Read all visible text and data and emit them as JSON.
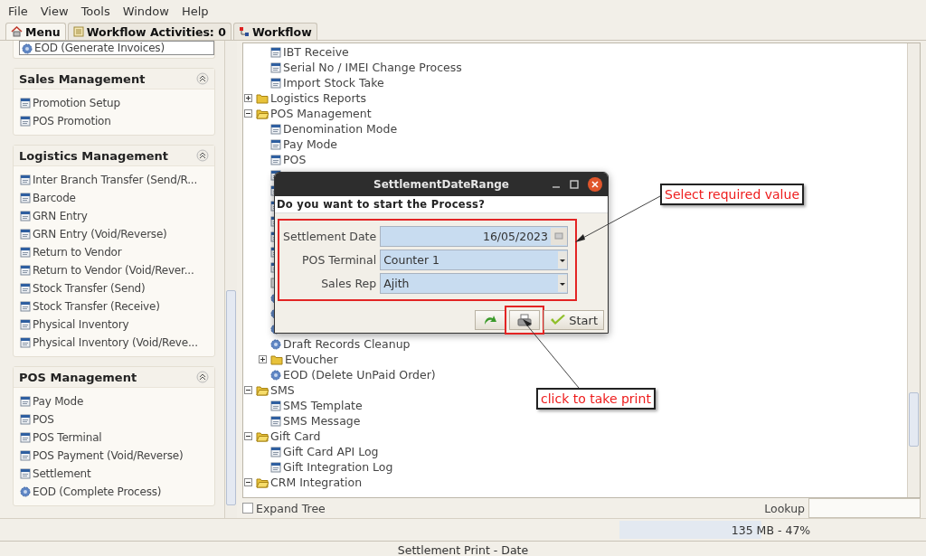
{
  "menu_bar": [
    "File",
    "View",
    "Tools",
    "Window",
    "Help"
  ],
  "tabs": [
    {
      "label": "Menu",
      "selected": true
    },
    {
      "label": "Workflow Activities: 0",
      "selected": false
    },
    {
      "label": "Workflow",
      "selected": false
    }
  ],
  "sidebar": {
    "sections": [
      {
        "items": [
          {
            "label": "EOD (Generate Invoices)",
            "kind": "process",
            "selected": true
          }
        ]
      },
      {
        "title": "Sales Management",
        "items": [
          {
            "label": "Promotion Setup",
            "kind": "form",
            "selected": false
          },
          {
            "label": "POS Promotion",
            "kind": "form",
            "selected": false
          }
        ]
      },
      {
        "title": "Logistics Management",
        "items": [
          {
            "label": "Inter Branch Transfer (Send/R...",
            "kind": "form",
            "selected": false
          },
          {
            "label": "Barcode",
            "kind": "form",
            "selected": false
          },
          {
            "label": "GRN Entry",
            "kind": "form",
            "selected": false
          },
          {
            "label": "GRN Entry (Void/Reverse)",
            "kind": "form",
            "selected": false
          },
          {
            "label": "Return to Vendor",
            "kind": "form",
            "selected": false
          },
          {
            "label": "Return to Vendor (Void/Rever...",
            "kind": "form",
            "selected": false
          },
          {
            "label": "Stock Transfer (Send)",
            "kind": "form",
            "selected": false
          },
          {
            "label": "Stock Transfer (Receive)",
            "kind": "form",
            "selected": false
          },
          {
            "label": "Physical Inventory",
            "kind": "form",
            "selected": false
          },
          {
            "label": "Physical Inventory (Void/Reve...",
            "kind": "form",
            "selected": false
          }
        ]
      },
      {
        "title": "POS Management",
        "items": [
          {
            "label": "Pay Mode",
            "kind": "form",
            "selected": false
          },
          {
            "label": "POS",
            "kind": "form",
            "selected": false
          },
          {
            "label": "POS Terminal",
            "kind": "form",
            "selected": false
          },
          {
            "label": "POS Payment (Void/Reverse)",
            "kind": "form",
            "selected": false
          },
          {
            "label": "Settlement",
            "kind": "form",
            "selected": false
          },
          {
            "label": "EOD (Complete Process)",
            "kind": "process",
            "selected": false
          }
        ]
      }
    ]
  },
  "tree": [
    {
      "kind": "continued",
      "children": [
        {
          "label": "IBT Receive",
          "kind": "form"
        },
        {
          "label": "Serial No / IMEI Change Process",
          "kind": "form"
        },
        {
          "label": "Import Stock Take",
          "kind": "form"
        }
      ]
    },
    {
      "label": "Logistics Reports",
      "kind": "folder",
      "expanded": false
    },
    {
      "label": "POS Management",
      "kind": "folder",
      "expanded": true,
      "children": [
        {
          "label": "Denomination Mode",
          "kind": "form"
        },
        {
          "label": "Pay Mode",
          "kind": "form"
        },
        {
          "label": "POS",
          "kind": "form"
        },
        {
          "kind": "form"
        },
        {
          "kind": "form"
        },
        {
          "kind": "form"
        },
        {
          "kind": "form"
        },
        {
          "kind": "form"
        },
        {
          "kind": "form"
        },
        {
          "kind": "form"
        },
        {
          "kind": "blank"
        },
        {
          "kind": "process"
        },
        {
          "kind": "process"
        },
        {
          "kind": "process"
        },
        {
          "label": "Draft Records Cleanup",
          "kind": "process"
        },
        {
          "label": "EVoucher",
          "kind": "folder",
          "expanded": false
        },
        {
          "label": "EOD (Delete UnPaid Order)",
          "kind": "process"
        }
      ]
    },
    {
      "label": "SMS",
      "kind": "folder",
      "expanded": true,
      "children": [
        {
          "label": "SMS Template",
          "kind": "form"
        },
        {
          "label": "SMS Message",
          "kind": "form"
        }
      ]
    },
    {
      "label": "Gift Card",
      "kind": "folder",
      "expanded": true,
      "children": [
        {
          "label": "Gift Card API Log",
          "kind": "form"
        },
        {
          "label": "Gift Integration Log",
          "kind": "form"
        }
      ]
    },
    {
      "label": "CRM Integration",
      "kind": "folder",
      "expanded": true
    }
  ],
  "expand_tree": {
    "label": "Expand Tree",
    "checked": false
  },
  "lookup": {
    "label": "Lookup"
  },
  "memory": {
    "text": "135 MB - 47%",
    "level": 0.47
  },
  "status_bar": "Settlement Print - Date",
  "dialog": {
    "title": "SettlementDateRange",
    "question": "Do you want to start the Process?",
    "fields": [
      {
        "label": "Settlement Date",
        "value": "16/05/2023",
        "kind": "date"
      },
      {
        "label": "POS Terminal",
        "value": "Counter 1",
        "kind": "combo"
      },
      {
        "label": "Sales Rep",
        "value": "Ajith",
        "kind": "combo"
      }
    ],
    "buttons": [
      {
        "kind": "next"
      },
      {
        "kind": "print"
      },
      {
        "kind": "start",
        "label": "Start"
      }
    ]
  },
  "callouts": [
    {
      "text": "Select required value"
    },
    {
      "text": "click to take print"
    }
  ]
}
